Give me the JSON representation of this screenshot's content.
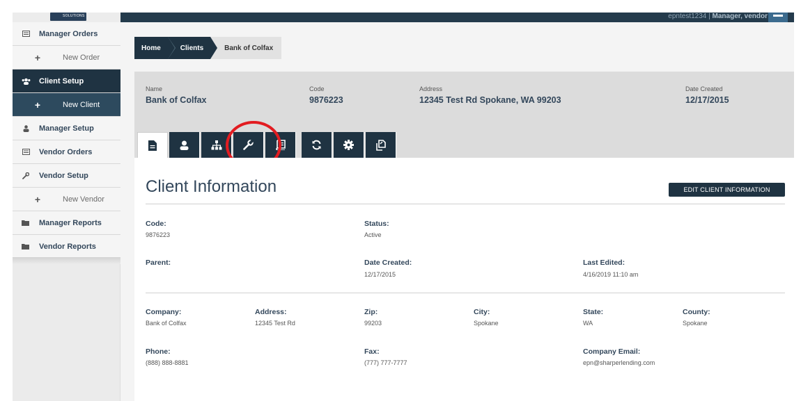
{
  "header": {
    "logo_text": "SOLUTIONS",
    "user_name": "epntest1234",
    "user_roles": "Manager, vendor",
    "separator": "|"
  },
  "sidebar": {
    "items": [
      {
        "label": "Manager Orders",
        "icon": "list-icon"
      },
      {
        "label": "New Order",
        "icon": "plus-icon"
      },
      {
        "label": "Client Setup",
        "icon": "users-icon"
      },
      {
        "label": "New Client",
        "icon": "plus-icon"
      },
      {
        "label": "Manager Setup",
        "icon": "user-icon"
      },
      {
        "label": "Vendor Orders",
        "icon": "list-icon"
      },
      {
        "label": "Vendor Setup",
        "icon": "wrench-icon"
      },
      {
        "label": "New Vendor",
        "icon": "plus-icon"
      },
      {
        "label": "Manager Reports",
        "icon": "folder-icon"
      },
      {
        "label": "Vendor Reports",
        "icon": "folder-icon"
      }
    ]
  },
  "breadcrumb": {
    "home": "Home",
    "clients": "Clients",
    "current": "Bank of Colfax"
  },
  "summary": {
    "name_label": "Name",
    "name": "Bank of Colfax",
    "code_label": "Code",
    "code": "9876223",
    "address_label": "Address",
    "address": "12345 Test Rd Spokane, WA 99203",
    "date_label": "Date Created",
    "date": "12/17/2015"
  },
  "tabs": [
    {
      "icon": "document-icon"
    },
    {
      "icon": "user-icon"
    },
    {
      "icon": "sitemap-icon"
    },
    {
      "icon": "wrench-icon"
    },
    {
      "icon": "book-icon"
    },
    {
      "icon": "refresh-icon"
    },
    {
      "icon": "gear-icon"
    },
    {
      "icon": "copy-icon"
    }
  ],
  "panel": {
    "title": "Client Information",
    "edit_button": "EDIT CLIENT INFORMATION",
    "fields": {
      "code_label": "Code:",
      "code": "9876223",
      "status_label": "Status:",
      "status": "Active",
      "parent_label": "Parent:",
      "date_created_label": "Date Created:",
      "date_created": "12/17/2015",
      "last_edited_label": "Last Edited:",
      "last_edited": "4/16/2019 11:10 am",
      "company_label": "Company:",
      "company": "Bank of Colfax",
      "address_label": "Address:",
      "address": "12345 Test Rd",
      "zip_label": "Zip:",
      "zip": "99203",
      "city_label": "City:",
      "city": "Spokane",
      "state_label": "State:",
      "state": "WA",
      "county_label": "County:",
      "county": "Spokane",
      "phone_label": "Phone:",
      "phone": "(888) 888-8881",
      "fax_label": "Fax:",
      "fax": "(777) 777-7777",
      "email_label": "Company Email:",
      "email": "epn@sharperlending.com"
    }
  }
}
